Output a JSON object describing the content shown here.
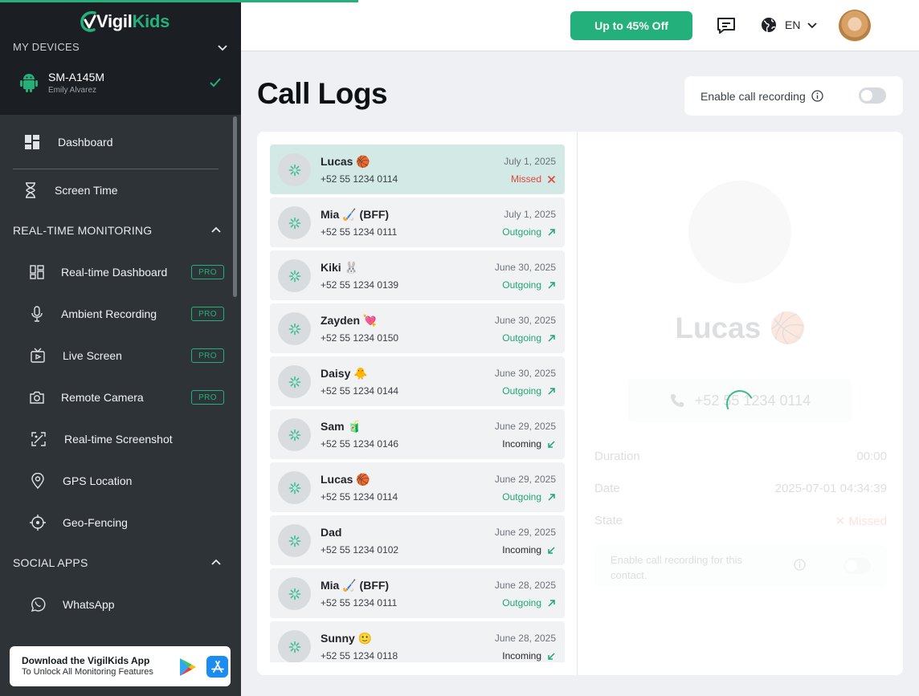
{
  "brand": {
    "name_part1": "Vigil",
    "name_part2": "Kids",
    "accent": "#23b07a"
  },
  "sidebar": {
    "my_devices_label": "MY DEVICES",
    "device": {
      "model": "SM-A145M",
      "owner": "Emily Alvarez",
      "icon": "android-icon"
    },
    "items": {
      "dashboard": "Dashboard",
      "screen_time": "Screen Time"
    },
    "realtime_section": "REAL-TIME MONITORING",
    "realtime_items": [
      {
        "label": "Real-time Dashboard",
        "badge": "PRO"
      },
      {
        "label": "Ambient Recording",
        "badge": "PRO"
      },
      {
        "label": "Live Screen",
        "badge": "PRO"
      },
      {
        "label": "Remote Camera",
        "badge": "PRO"
      },
      {
        "label": "Real-time Screenshot"
      },
      {
        "label": "GPS Location"
      },
      {
        "label": "Geo-Fencing"
      }
    ],
    "social_section": "SOCIAL APPS",
    "social_items": [
      {
        "label": "WhatsApp"
      }
    ],
    "download": {
      "title": "Download the VigilKids App",
      "subtitle": "To Unlock All Monitoring Features"
    }
  },
  "topbar": {
    "promo": "Up to 45% Off",
    "language": "EN"
  },
  "main": {
    "title": "Call Logs",
    "enable_recording_label": "Enable call recording"
  },
  "calls": [
    {
      "name": "Lucas 🏀",
      "phone": "+52 55 1234 0114",
      "date": "July 1, 2025",
      "status": "Missed",
      "type": "missed"
    },
    {
      "name": "Mia 🏑 (BFF)",
      "phone": "+52 55 1234 0111",
      "date": "July 1, 2025",
      "status": "Outgoing",
      "type": "outgoing"
    },
    {
      "name": "Kiki 🐰",
      "phone": "+52 55 1234 0139",
      "date": "June 30, 2025",
      "status": "Outgoing",
      "type": "outgoing"
    },
    {
      "name": "Zayden 💘",
      "phone": "+52 55 1234 0150",
      "date": "June 30, 2025",
      "status": "Outgoing",
      "type": "outgoing"
    },
    {
      "name": "Daisy 🐥",
      "phone": "+52 55 1234 0144",
      "date": "June 30, 2025",
      "status": "Outgoing",
      "type": "outgoing"
    },
    {
      "name": "Sam 🧃",
      "phone": "+52 55 1234 0146",
      "date": "June 29, 2025",
      "status": "Incoming",
      "type": "incoming"
    },
    {
      "name": "Lucas 🏀",
      "phone": "+52 55 1234 0114",
      "date": "June 29, 2025",
      "status": "Outgoing",
      "type": "outgoing"
    },
    {
      "name": "Dad",
      "phone": "+52 55 1234 0102",
      "date": "June 29, 2025",
      "status": "Incoming",
      "type": "incoming"
    },
    {
      "name": "Mia 🏑 (BFF)",
      "phone": "+52 55 1234 0111",
      "date": "June 28, 2025",
      "status": "Outgoing",
      "type": "outgoing"
    },
    {
      "name": "Sunny 🙂",
      "phone": "+52 55 1234 0118",
      "date": "June 28, 2025",
      "status": "Incoming",
      "type": "incoming"
    }
  ],
  "detail": {
    "name": "Lucas 🏀",
    "phone": "+52 55 1234 0114",
    "duration_label": "Duration",
    "duration_value": "00:00",
    "date_label": "Date",
    "date_value": "2025-07-01 04:34:39",
    "state_label": "State",
    "state_value": "✕ Missed",
    "contact_recording_label": "Enable call recording for this contact."
  }
}
